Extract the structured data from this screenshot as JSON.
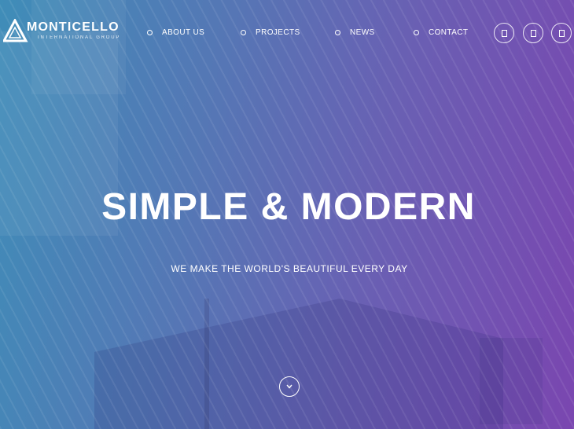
{
  "brand": {
    "name": "MONTICELLO",
    "tagline": "INTERNATIONAL GROUP",
    "logo_icon": "triangle-logo-icon"
  },
  "nav": {
    "items": [
      {
        "label": "ABOUT US",
        "icon": "circle-bullet-icon"
      },
      {
        "label": "PROJECTS",
        "icon": "circle-bullet-icon"
      },
      {
        "label": "NEWS",
        "icon": "circle-bullet-icon"
      },
      {
        "label": "CONTACT",
        "icon": "circle-bullet-icon"
      }
    ]
  },
  "social": {
    "buttons": [
      {
        "icon": "social-icon"
      },
      {
        "icon": "social-icon"
      },
      {
        "icon": "social-icon"
      }
    ]
  },
  "hero": {
    "headline": "SIMPLE & MODERN",
    "subtitle": "WE MAKE THE WORLD'S BEAUTIFUL EVERY DAY",
    "scroll_icon": "chevron-down-icon"
  },
  "colors": {
    "gradient_start": "#3f8db8",
    "gradient_end": "#7a46b0",
    "text": "#ffffff"
  }
}
